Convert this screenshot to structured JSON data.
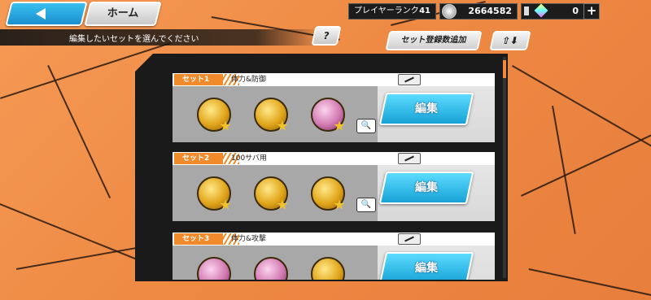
{
  "topbar": {
    "home_label": "ホーム",
    "player_rank_label": "プレイヤーランク",
    "player_rank_value": "41",
    "coins_value": "2664582",
    "gems_value": "0",
    "plus_label": "+"
  },
  "toolbar": {
    "hint_text": "編集したいセットを選んでください",
    "help_label": "?",
    "add_set_label": "セット登録数追加",
    "sort_label": "⇧⬇"
  },
  "sets": [
    {
      "tag": "セット1",
      "name": "体力&防御",
      "edit_label": "編集",
      "medals": [
        {
          "color": "gold",
          "level": "9"
        },
        {
          "color": "gold",
          "level": "9"
        },
        {
          "color": "pink",
          "level": "9"
        }
      ]
    },
    {
      "tag": "セット2",
      "name": "100サバ用",
      "edit_label": "編集",
      "medals": [
        {
          "color": "gold",
          "level": "9"
        },
        {
          "color": "gold",
          "level": "9"
        },
        {
          "color": "gold",
          "level": "9"
        }
      ]
    },
    {
      "tag": "セット3",
      "name": "体力&攻撃",
      "edit_label": "編集",
      "medals": [
        {
          "color": "pink",
          "level": ""
        },
        {
          "color": "pink",
          "level": ""
        },
        {
          "color": "gold",
          "level": ""
        }
      ]
    }
  ],
  "colors": {
    "accent_orange": "#f08a2a",
    "button_blue": "#17a2d6"
  }
}
